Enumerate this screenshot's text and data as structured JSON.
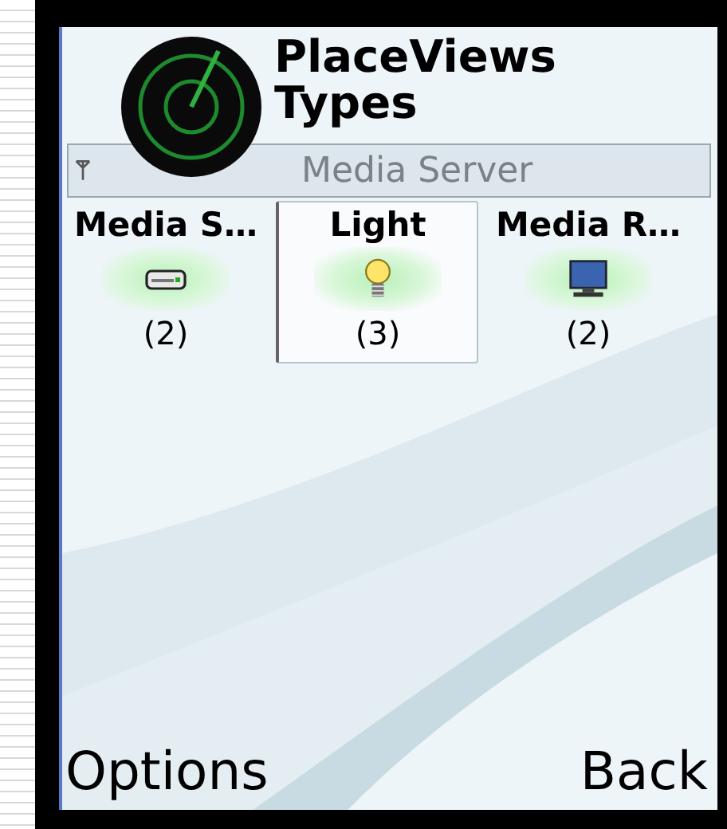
{
  "title": {
    "lines": [
      "PlaceViews",
      "Types"
    ]
  },
  "navi_pane": {
    "label": "Media Server"
  },
  "grid": [
    {
      "label": "Media S…",
      "count": "(2)",
      "kind": "server",
      "selected": false
    },
    {
      "label": "Light",
      "count": "(3)",
      "kind": "light",
      "selected": true
    },
    {
      "label": "Media R…",
      "count": "(2)",
      "kind": "renderer",
      "selected": false
    }
  ],
  "softkeys": {
    "left": "Options",
    "right": "Back"
  }
}
